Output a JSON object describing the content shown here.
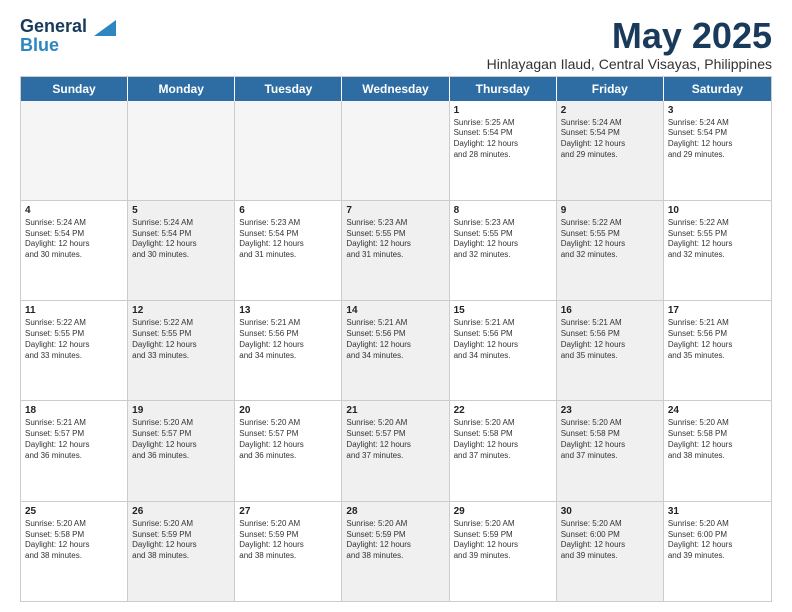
{
  "logo": {
    "line1": "General",
    "line2": "Blue"
  },
  "title": "May 2025",
  "subtitle": "Hinlayagan Ilaud, Central Visayas, Philippines",
  "header_days": [
    "Sunday",
    "Monday",
    "Tuesday",
    "Wednesday",
    "Thursday",
    "Friday",
    "Saturday"
  ],
  "weeks": [
    [
      {
        "day": "",
        "info": "",
        "shaded": true,
        "empty": true
      },
      {
        "day": "",
        "info": "",
        "shaded": true,
        "empty": true
      },
      {
        "day": "",
        "info": "",
        "shaded": true,
        "empty": true
      },
      {
        "day": "",
        "info": "",
        "shaded": true,
        "empty": true
      },
      {
        "day": "1",
        "info": "Sunrise: 5:25 AM\nSunset: 5:54 PM\nDaylight: 12 hours\nand 28 minutes.",
        "shaded": false
      },
      {
        "day": "2",
        "info": "Sunrise: 5:24 AM\nSunset: 5:54 PM\nDaylight: 12 hours\nand 29 minutes.",
        "shaded": true
      },
      {
        "day": "3",
        "info": "Sunrise: 5:24 AM\nSunset: 5:54 PM\nDaylight: 12 hours\nand 29 minutes.",
        "shaded": false
      }
    ],
    [
      {
        "day": "4",
        "info": "Sunrise: 5:24 AM\nSunset: 5:54 PM\nDaylight: 12 hours\nand 30 minutes.",
        "shaded": false
      },
      {
        "day": "5",
        "info": "Sunrise: 5:24 AM\nSunset: 5:54 PM\nDaylight: 12 hours\nand 30 minutes.",
        "shaded": true
      },
      {
        "day": "6",
        "info": "Sunrise: 5:23 AM\nSunset: 5:54 PM\nDaylight: 12 hours\nand 31 minutes.",
        "shaded": false
      },
      {
        "day": "7",
        "info": "Sunrise: 5:23 AM\nSunset: 5:55 PM\nDaylight: 12 hours\nand 31 minutes.",
        "shaded": true
      },
      {
        "day": "8",
        "info": "Sunrise: 5:23 AM\nSunset: 5:55 PM\nDaylight: 12 hours\nand 32 minutes.",
        "shaded": false
      },
      {
        "day": "9",
        "info": "Sunrise: 5:22 AM\nSunset: 5:55 PM\nDaylight: 12 hours\nand 32 minutes.",
        "shaded": true
      },
      {
        "day": "10",
        "info": "Sunrise: 5:22 AM\nSunset: 5:55 PM\nDaylight: 12 hours\nand 32 minutes.",
        "shaded": false
      }
    ],
    [
      {
        "day": "11",
        "info": "Sunrise: 5:22 AM\nSunset: 5:55 PM\nDaylight: 12 hours\nand 33 minutes.",
        "shaded": false
      },
      {
        "day": "12",
        "info": "Sunrise: 5:22 AM\nSunset: 5:55 PM\nDaylight: 12 hours\nand 33 minutes.",
        "shaded": true
      },
      {
        "day": "13",
        "info": "Sunrise: 5:21 AM\nSunset: 5:56 PM\nDaylight: 12 hours\nand 34 minutes.",
        "shaded": false
      },
      {
        "day": "14",
        "info": "Sunrise: 5:21 AM\nSunset: 5:56 PM\nDaylight: 12 hours\nand 34 minutes.",
        "shaded": true
      },
      {
        "day": "15",
        "info": "Sunrise: 5:21 AM\nSunset: 5:56 PM\nDaylight: 12 hours\nand 34 minutes.",
        "shaded": false
      },
      {
        "day": "16",
        "info": "Sunrise: 5:21 AM\nSunset: 5:56 PM\nDaylight: 12 hours\nand 35 minutes.",
        "shaded": true
      },
      {
        "day": "17",
        "info": "Sunrise: 5:21 AM\nSunset: 5:56 PM\nDaylight: 12 hours\nand 35 minutes.",
        "shaded": false
      }
    ],
    [
      {
        "day": "18",
        "info": "Sunrise: 5:21 AM\nSunset: 5:57 PM\nDaylight: 12 hours\nand 36 minutes.",
        "shaded": false
      },
      {
        "day": "19",
        "info": "Sunrise: 5:20 AM\nSunset: 5:57 PM\nDaylight: 12 hours\nand 36 minutes.",
        "shaded": true
      },
      {
        "day": "20",
        "info": "Sunrise: 5:20 AM\nSunset: 5:57 PM\nDaylight: 12 hours\nand 36 minutes.",
        "shaded": false
      },
      {
        "day": "21",
        "info": "Sunrise: 5:20 AM\nSunset: 5:57 PM\nDaylight: 12 hours\nand 37 minutes.",
        "shaded": true
      },
      {
        "day": "22",
        "info": "Sunrise: 5:20 AM\nSunset: 5:58 PM\nDaylight: 12 hours\nand 37 minutes.",
        "shaded": false
      },
      {
        "day": "23",
        "info": "Sunrise: 5:20 AM\nSunset: 5:58 PM\nDaylight: 12 hours\nand 37 minutes.",
        "shaded": true
      },
      {
        "day": "24",
        "info": "Sunrise: 5:20 AM\nSunset: 5:58 PM\nDaylight: 12 hours\nand 38 minutes.",
        "shaded": false
      }
    ],
    [
      {
        "day": "25",
        "info": "Sunrise: 5:20 AM\nSunset: 5:58 PM\nDaylight: 12 hours\nand 38 minutes.",
        "shaded": false
      },
      {
        "day": "26",
        "info": "Sunrise: 5:20 AM\nSunset: 5:59 PM\nDaylight: 12 hours\nand 38 minutes.",
        "shaded": true
      },
      {
        "day": "27",
        "info": "Sunrise: 5:20 AM\nSunset: 5:59 PM\nDaylight: 12 hours\nand 38 minutes.",
        "shaded": false
      },
      {
        "day": "28",
        "info": "Sunrise: 5:20 AM\nSunset: 5:59 PM\nDaylight: 12 hours\nand 38 minutes.",
        "shaded": true
      },
      {
        "day": "29",
        "info": "Sunrise: 5:20 AM\nSunset: 5:59 PM\nDaylight: 12 hours\nand 39 minutes.",
        "shaded": false
      },
      {
        "day": "30",
        "info": "Sunrise: 5:20 AM\nSunset: 6:00 PM\nDaylight: 12 hours\nand 39 minutes.",
        "shaded": true
      },
      {
        "day": "31",
        "info": "Sunrise: 5:20 AM\nSunset: 6:00 PM\nDaylight: 12 hours\nand 39 minutes.",
        "shaded": false
      }
    ]
  ]
}
